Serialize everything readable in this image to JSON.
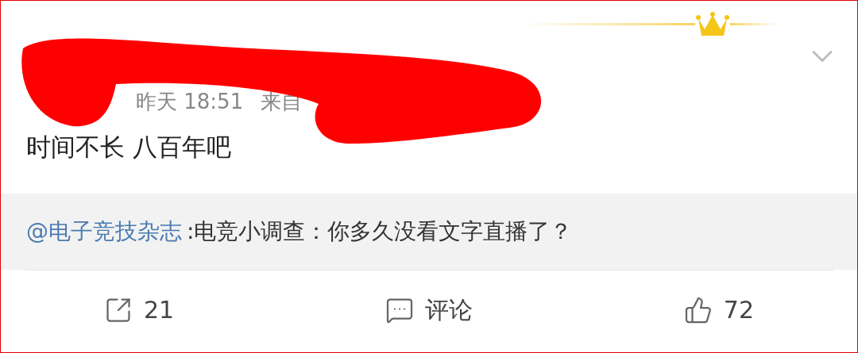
{
  "post": {
    "time": "昨天 18:51",
    "source_prefix": "来自",
    "text": "时间不长 八百年吧"
  },
  "repost": {
    "mention": "@电子竞技杂志",
    "text": ":电竞小调查：你多久没看文字直播了？"
  },
  "actions": [
    {
      "kind": "repost",
      "label": "21"
    },
    {
      "kind": "comment",
      "label": "评论"
    },
    {
      "kind": "like",
      "label": "72"
    }
  ]
}
